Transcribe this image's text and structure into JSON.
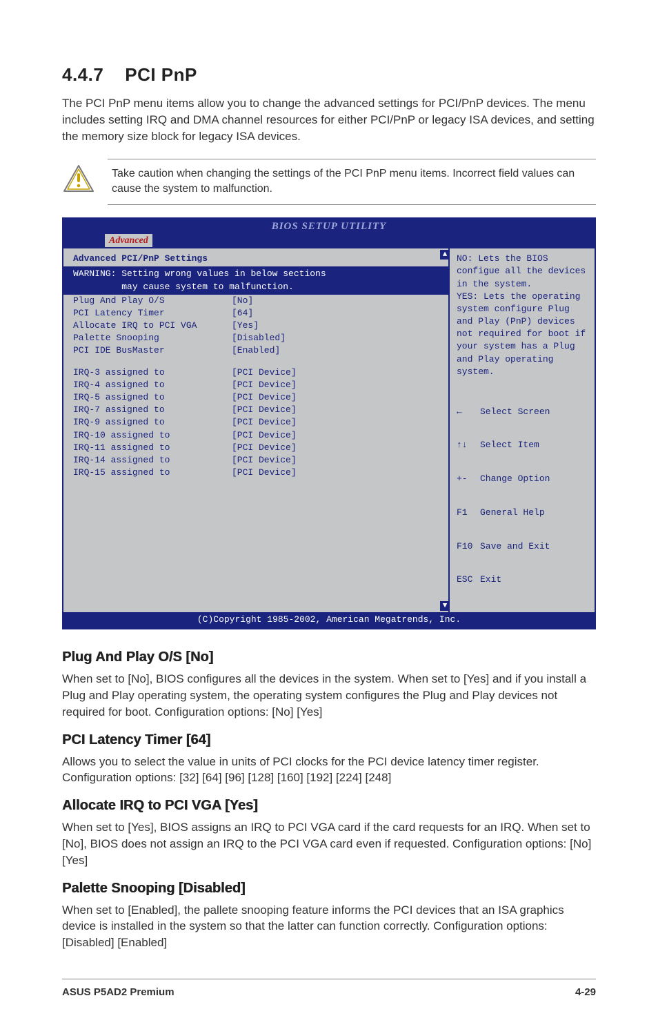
{
  "section": {
    "number": "4.4.7",
    "title": "PCI PnP",
    "intro": "The PCI PnP menu items allow you to change the advanced settings for PCI/PnP devices. The menu includes setting IRQ and DMA channel resources for either PCI/PnP or legacy ISA devices, and setting the memory size block for legacy ISA devices."
  },
  "caution": {
    "text": "Take caution when changing the settings of the PCI PnP menu items. Incorrect field values can cause the system to malfunction."
  },
  "bios": {
    "title": "BIOS SETUP UTILITY",
    "tab": "Advanced",
    "panel_heading": "Advanced PCI/PnP Settings",
    "warning": "WARNING: Setting wrong values in below sections\n         may cause system to malfunction.",
    "group1": [
      {
        "label": "Plug And Play O/S",
        "value": "[No]"
      },
      {
        "label": "PCI Latency Timer",
        "value": "[64]"
      },
      {
        "label": "Allocate IRQ to PCI VGA",
        "value": "[Yes]"
      },
      {
        "label": "Palette Snooping",
        "value": "[Disabled]"
      },
      {
        "label": "PCI IDE BusMaster",
        "value": "[Enabled]"
      }
    ],
    "group2": [
      {
        "label": "IRQ-3 assigned to",
        "value": "[PCI Device]"
      },
      {
        "label": "IRQ-4 assigned to",
        "value": "[PCI Device]"
      },
      {
        "label": "IRQ-5 assigned to",
        "value": "[PCI Device]"
      },
      {
        "label": "IRQ-7 assigned to",
        "value": "[PCI Device]"
      },
      {
        "label": "IRQ-9 assigned to",
        "value": "[PCI Device]"
      },
      {
        "label": "IRQ-10 assigned to",
        "value": "[PCI Device]"
      },
      {
        "label": "IRQ-11 assigned to",
        "value": "[PCI Device]"
      },
      {
        "label": "IRQ-14 assigned to",
        "value": "[PCI Device]"
      },
      {
        "label": "IRQ-15 assigned to",
        "value": "[PCI Device]"
      }
    ],
    "help": "NO: Lets the BIOS configue all the devices in the system.\nYES: Lets the operating system configure Plug and Play (PnP) devices not required for boot if your system has a Plug and Play operating system.",
    "keys": [
      {
        "sym": "←",
        "desc": "Select Screen"
      },
      {
        "sym": "↑↓",
        "desc": "Select Item"
      },
      {
        "sym": "+-",
        "desc": "Change Option"
      },
      {
        "sym": "F1",
        "desc": "General Help"
      },
      {
        "sym": "F10",
        "desc": "Save and Exit"
      },
      {
        "sym": "ESC",
        "desc": "Exit"
      }
    ],
    "footer": "(C)Copyright 1985-2002, American Megatrends, Inc."
  },
  "subsections": [
    {
      "title": "Plug And Play O/S [No]",
      "text": "When set to [No], BIOS configures all the devices in the system. When set to [Yes] and if you install a Plug and Play operating system, the operating system configures the Plug and Play devices not required for boot. Configuration options: [No] [Yes]"
    },
    {
      "title": "PCI Latency Timer [64]",
      "text": "Allows you to select the value in units of PCI clocks for the PCI device latency timer register. Configuration options: [32] [64] [96] [128] [160] [192] [224] [248]"
    },
    {
      "title": "Allocate IRQ to PCI VGA [Yes]",
      "text": "When set to [Yes], BIOS assigns an IRQ to PCI VGA card if the card requests for an IRQ. When set to [No], BIOS does not assign an IRQ to the PCI VGA card even if requested. Configuration options: [No] [Yes]"
    },
    {
      "title": "Palette Snooping [Disabled]",
      "text": "When set to [Enabled], the pallete snooping feature informs the PCI devices that an ISA graphics device is installed in the system so that the latter can function correctly. Configuration options: [Disabled] [Enabled]"
    }
  ],
  "footer": {
    "left": "ASUS P5AD2 Premium",
    "right": "4-29"
  }
}
